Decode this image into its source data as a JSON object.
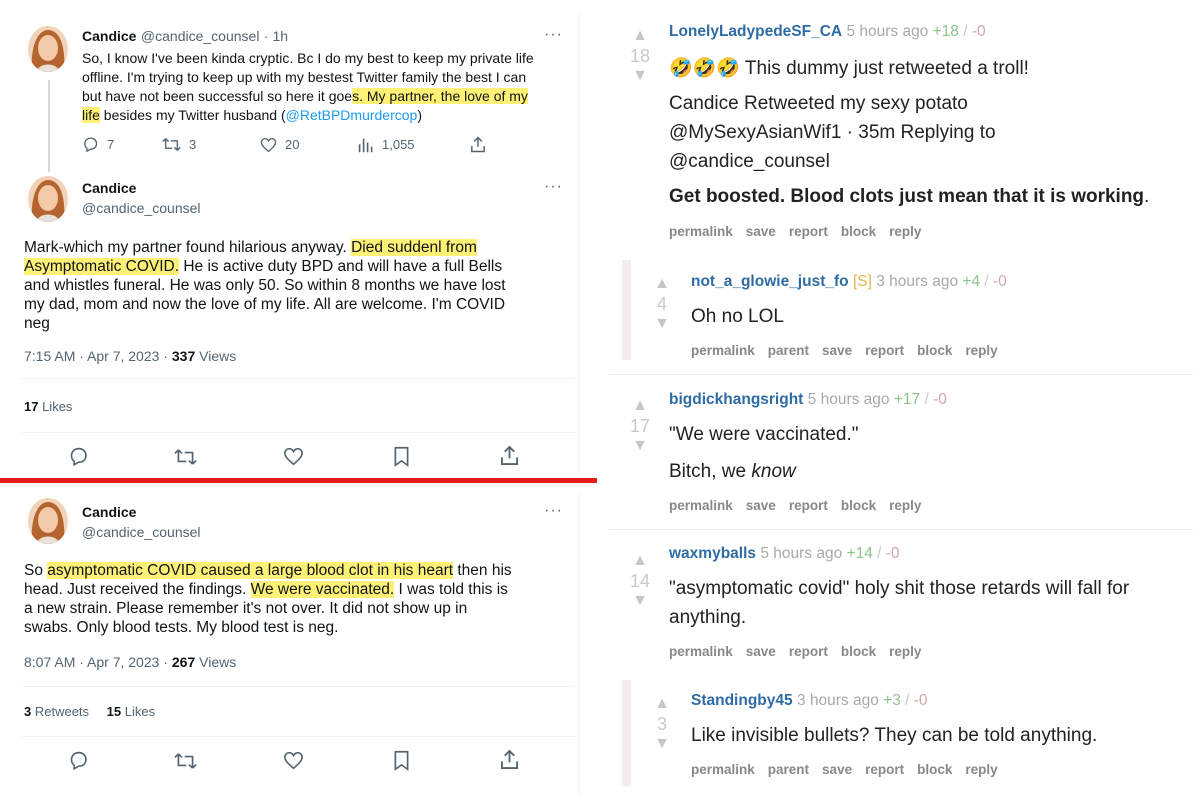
{
  "tweets": {
    "t1": {
      "name": "Candice",
      "handle": "@candice_counsel",
      "time": "· 1h",
      "more": "···",
      "line1": "So, I know I've been kinda cryptic.  Bc I do my best to keep my private life",
      "line2": "offline.  I'm trying to keep up with my bestest Twitter family the best I can",
      "line3a": "but have not been successful so here it goe",
      "line3b": "s.  My partner, the love of my",
      "line4a": "life",
      "line4b": " besides my Twitter husband (",
      "line4c": "@RetBPDmurdercop",
      "line4d": ")",
      "replies": "7",
      "retweets": "3",
      "likes": "20",
      "views": "1,055"
    },
    "t2": {
      "name": "Candice",
      "handle": "@candice_counsel",
      "more": "···",
      "line1a": "Mark-which my partner found hilarious anyway. ",
      "line1b": " Died suddenl from",
      "line2a": "Asymptomatic COVID.",
      "line2b": "  He is active duty BPD and will have a full Bells",
      "line3": "and whistles funeral.  He was only 50.  So within 8 months we have lost",
      "line4": "my dad, mom and now the love of my life.  All are welcome. I'm COVID",
      "line5": "neg",
      "timestamp": "7:15 AM · Apr 7, 2023 · ",
      "views_count": "337",
      "views_label": " Views",
      "likes_count": "17",
      "likes_label": " Likes"
    },
    "t3": {
      "name": "Candice",
      "handle": "@candice_counsel",
      "more": "···",
      "line1a": "So ",
      "line1b": "asymptomatic COVID caused a large blood clot in his heart",
      "line1c": " then his",
      "line2a": "head.  Just received the findings.  ",
      "line2b": "We were vaccinated.",
      "line2c": "  I was told this is",
      "line3": "a new strain.  Please remember it's not over.   It did not show up in",
      "line4": "swabs.  Only blood tests. My blood test is neg.",
      "timestamp": "8:07 AM · Apr 7, 2023 · ",
      "views_count": "267",
      "views_label": " Views",
      "rt_count": "3",
      "rt_label": " Retweets",
      "likes_count": "15",
      "likes_label": " Likes"
    }
  },
  "comments": [
    {
      "author": "LonelyLadypedeSF_CA",
      "time": "5 hours ago",
      "plus": "+18",
      "minus": "-0",
      "score": "18",
      "line1": "🤣🤣🤣 This dummy just retweeted a troll!",
      "line2": "Candice Retweeted my sexy potato",
      "line3": "@MySexyAsianWif1 · 35m Replying to",
      "line4": "@candice_counsel",
      "line5a": "Get boosted. Blood clots just mean that it is working",
      "line5b": ".",
      "links": [
        "permalink",
        "save",
        "report",
        "block",
        "reply"
      ]
    },
    {
      "author": "not_a_glowie_just_fo",
      "tag": "[S]",
      "time": "3 hours ago",
      "plus": "+4",
      "minus": "-0",
      "score": "4",
      "line1": "Oh no LOL",
      "links": [
        "permalink",
        "parent",
        "save",
        "report",
        "block",
        "reply"
      ]
    },
    {
      "author": "bigdickhangsright",
      "time": "5 hours ago",
      "plus": "+17",
      "minus": "-0",
      "score": "17",
      "line1": "\"We were vaccinated.\"",
      "line2a": "Bitch, we ",
      "line2b": "know",
      "links": [
        "permalink",
        "save",
        "report",
        "block",
        "reply"
      ]
    },
    {
      "author": "waxmyballs",
      "time": "5 hours ago",
      "plus": "+14",
      "minus": "-0",
      "score": "14",
      "line1": "\"asymptomatic covid\" holy shit those retards will fall for",
      "line2": "anything.",
      "links": [
        "permalink",
        "save",
        "report",
        "block",
        "reply"
      ]
    },
    {
      "author": "Standingby45",
      "time": "3 hours ago",
      "plus": "+3",
      "minus": "-0",
      "score": "3",
      "line1": "Like invisible bullets? They can be told anything.",
      "links": [
        "permalink",
        "parent",
        "save",
        "report",
        "block",
        "reply"
      ]
    }
  ],
  "icons": {
    "reply": "reply-icon",
    "retweet": "retweet-icon",
    "like": "heart-icon",
    "views": "views-icon",
    "share": "share-icon",
    "bookmark": "bookmark-icon",
    "upvote": "upvote-arrow-icon",
    "downvote": "downvote-arrow-icon"
  },
  "colors": {
    "highlight": "#fff176",
    "mention": "#1d9bf0",
    "divider_red": "#e41c1c",
    "author": "#2f6ba5",
    "plus": "#8bc48b",
    "minus": "#d3a6a6"
  },
  "vote_arrow": {
    "up": "▲",
    "down": "▼",
    "slash": " / "
  }
}
